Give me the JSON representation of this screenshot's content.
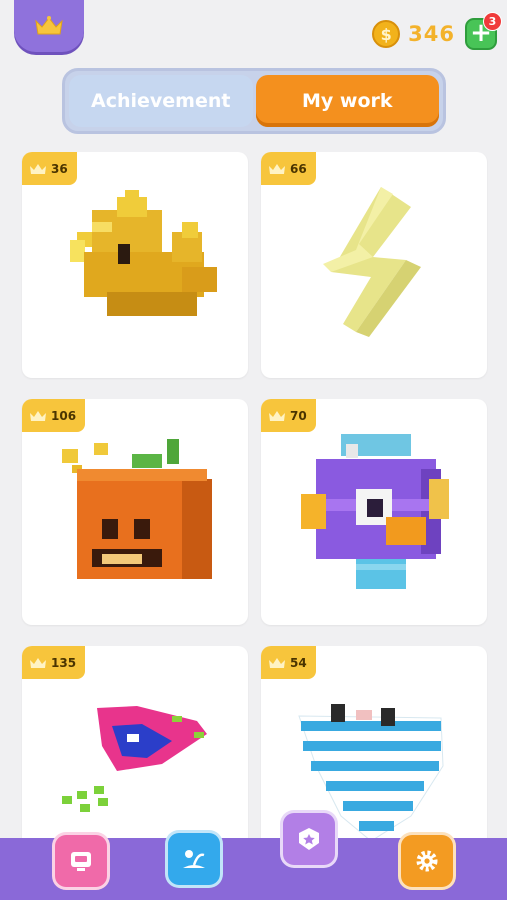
{
  "header": {
    "crown_icon": "crown-icon",
    "coins": "346",
    "coin_symbol": "$",
    "add_coins_icon": "plus-icon",
    "notification_count": "3"
  },
  "tabs": [
    {
      "label": "Achievement",
      "active": false
    },
    {
      "label": "My work",
      "active": true
    }
  ],
  "works": [
    {
      "name": "yellow-duck",
      "count": "36"
    },
    {
      "name": "lightning-bolt",
      "count": "66"
    },
    {
      "name": "pumpkin",
      "count": "106"
    },
    {
      "name": "purple-fish",
      "count": "70"
    },
    {
      "name": "pink-spaceship",
      "count": "135"
    },
    {
      "name": "striped-cup",
      "count": "54"
    }
  ],
  "nav": [
    {
      "icon": "robot-icon",
      "color": "#f06aa9"
    },
    {
      "icon": "beach-icon",
      "color": "#33a9ec"
    },
    {
      "icon": "badge-icon",
      "color": "#b27fe6",
      "active": true
    },
    {
      "icon": "gear-icon",
      "color": "#f39b22"
    }
  ],
  "colors": {
    "accent_orange": "#f4901e",
    "coin_gold": "#f2b21b",
    "nav_purple": "#8a69d8"
  }
}
